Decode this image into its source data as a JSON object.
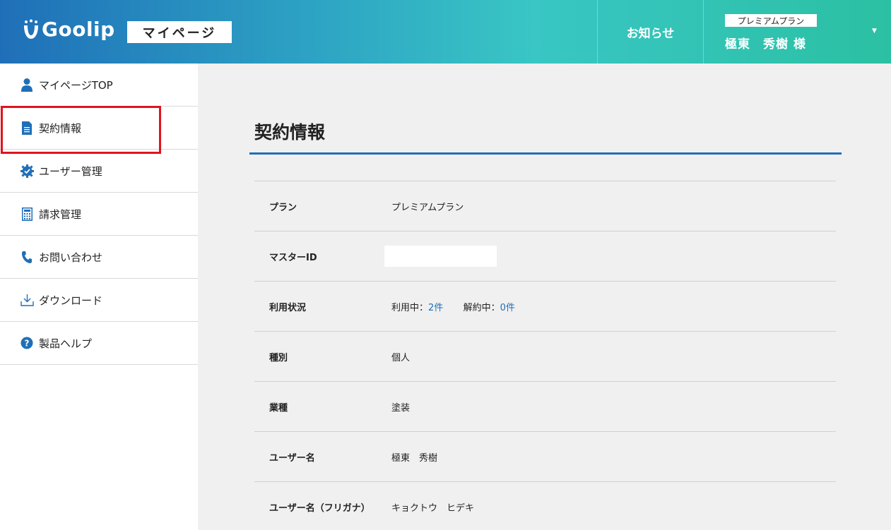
{
  "header": {
    "logo_text": "Goolip",
    "page_badge": "マイページ",
    "notice_label": "お知らせ",
    "plan_badge": "プレミアムプラン",
    "user_name": "極東　秀樹 様",
    "caret": "▼"
  },
  "sidebar": {
    "items": [
      {
        "label": "マイページTOP",
        "icon": "user-icon"
      },
      {
        "label": "契約情報",
        "icon": "document-icon"
      },
      {
        "label": "ユーザー管理",
        "icon": "gear-check-icon"
      },
      {
        "label": "請求管理",
        "icon": "calculator-icon"
      },
      {
        "label": "お問い合わせ",
        "icon": "phone-icon"
      },
      {
        "label": "ダウンロード",
        "icon": "download-icon"
      },
      {
        "label": "製品ヘルプ",
        "icon": "help-icon"
      }
    ]
  },
  "main": {
    "title": "契約情報",
    "rows": [
      {
        "label": "プラン",
        "value": "プレミアムプラン"
      },
      {
        "label": "マスターID",
        "value": ""
      },
      {
        "label": "利用状況",
        "in_use_label": "利用中：",
        "in_use_count": "2件",
        "cancel_label": "解約中：",
        "cancel_count": "0件"
      },
      {
        "label": "種別",
        "value": "個人"
      },
      {
        "label": "業種",
        "value": "塗装"
      },
      {
        "label": "ユーザー名",
        "value": "極東　秀樹"
      },
      {
        "label": "ユーザー名（フリガナ）",
        "value": "キョクトウ　ヒデキ"
      }
    ]
  },
  "colors": {
    "brand_blue": "#1f6fb8",
    "highlight_red": "#e0141e",
    "header_teal": "#2bc0a3"
  }
}
